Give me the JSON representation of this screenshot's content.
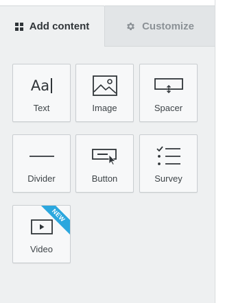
{
  "tabs": {
    "add_content": {
      "label": "Add content",
      "icon": "grid-icon",
      "active": true
    },
    "customize": {
      "label": "Customize",
      "icon": "gear-icon",
      "active": false
    }
  },
  "tiles": [
    {
      "label": "Text",
      "icon": "text-icon",
      "glyph": "Aa"
    },
    {
      "label": "Image",
      "icon": "image-icon"
    },
    {
      "label": "Spacer",
      "icon": "spacer-icon"
    },
    {
      "label": "Divider",
      "icon": "divider-icon"
    },
    {
      "label": "Button",
      "icon": "button-icon"
    },
    {
      "label": "Survey",
      "icon": "survey-icon"
    },
    {
      "label": "Video",
      "icon": "video-icon",
      "badge": "NEW"
    }
  ],
  "colors": {
    "panel_bg": "#eef0f1",
    "inactive_tab_bg": "#e2e5e7",
    "tile_bg": "#f7f8f9",
    "icon": "#2f3438",
    "badge": "#2ba7de"
  }
}
